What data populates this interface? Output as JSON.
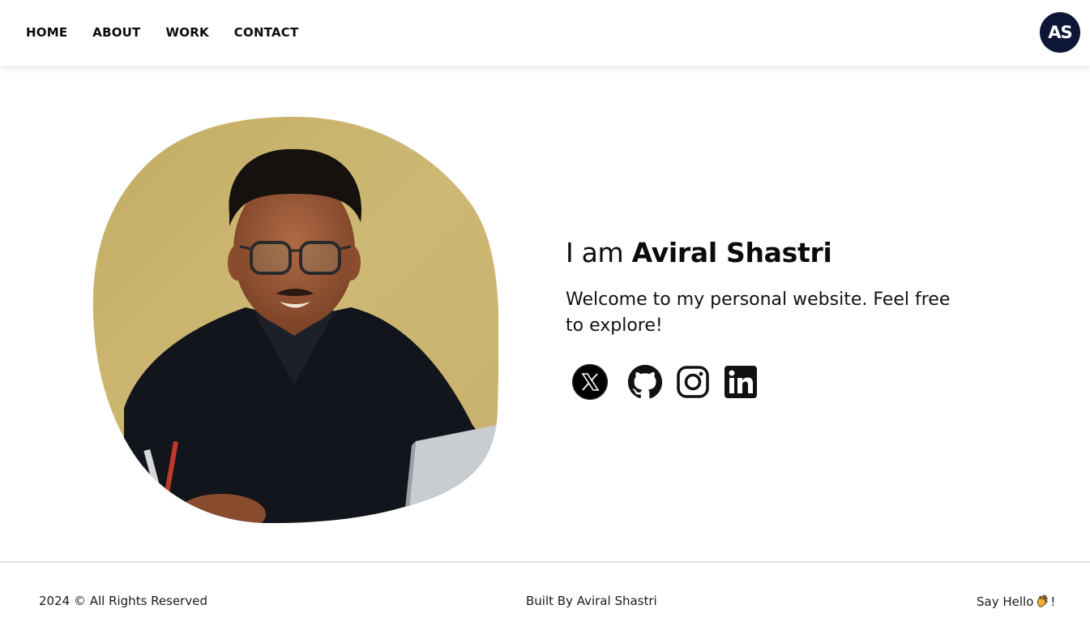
{
  "nav": {
    "links": [
      "HOME",
      "ABOUT",
      "WORK",
      "CONTACT"
    ],
    "logo_text": "AS"
  },
  "hero": {
    "greeting": "I am ",
    "name": "Aviral Shastri",
    "subtitle": "Welcome to my personal website. Feel free to explore!",
    "socials": [
      "x-icon",
      "github-icon",
      "instagram-icon",
      "linkedin-icon"
    ]
  },
  "footer": {
    "copyright": "2024 © All Rights Reserved",
    "built_by": "Built By Aviral Shastri",
    "say_hello": "Say Hello",
    "say_hello_suffix": "!"
  },
  "colors": {
    "logo_bg": "#0d1636",
    "photo_bg": "#c9b46e",
    "shirt": "#12151b"
  }
}
